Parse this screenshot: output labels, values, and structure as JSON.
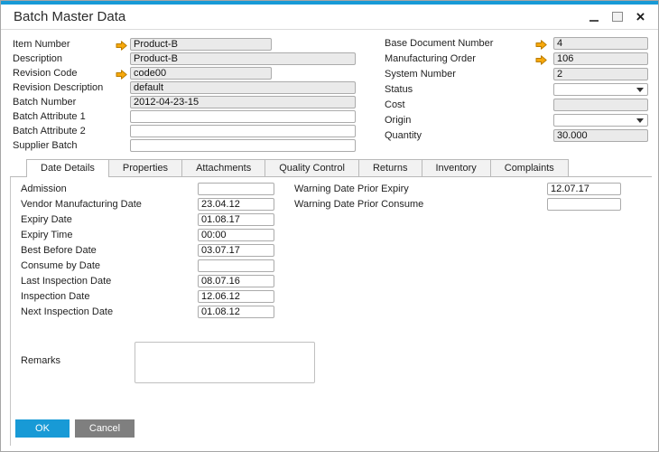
{
  "colors": {
    "accent_blue": "#189ad6",
    "ok_button_blue": "#189ad6",
    "cancel_button_gray": "#7f7f7f",
    "link_arrow_orange": "#f7a80b",
    "disabled_field_bg": "#eaeaea"
  },
  "icons": {
    "minimize": "underscore-shape",
    "maximize": "square-outline",
    "close": "×",
    "link_arrow": "orange-right-arrow",
    "dropdown_caret": "▾"
  },
  "window": {
    "title": "Batch Master Data"
  },
  "header_form": {
    "left_fields": [
      {
        "label": "Item Number",
        "value": "Product-B",
        "arrow": true,
        "type": "readonly",
        "size": "narrow"
      },
      {
        "label": "Description",
        "value": "Product-B",
        "arrow": false,
        "type": "readonly",
        "size": "wide"
      },
      {
        "label": "Revision Code",
        "value": "code00",
        "arrow": true,
        "type": "readonly",
        "size": "narrow"
      },
      {
        "label": "Revision Description",
        "value": "default",
        "arrow": false,
        "type": "readonly",
        "size": "wide"
      },
      {
        "label": "Batch Number",
        "value": "2012-04-23-15",
        "arrow": false,
        "type": "readonly",
        "size": "wide"
      },
      {
        "label": "Batch Attribute 1",
        "value": "",
        "arrow": false,
        "type": "input",
        "size": "wide"
      },
      {
        "label": "Batch Attribute 2",
        "value": "",
        "arrow": false,
        "type": "input",
        "size": "wide"
      },
      {
        "label": "Supplier Batch",
        "value": "",
        "arrow": false,
        "type": "input",
        "size": "wide"
      }
    ],
    "right_fields": [
      {
        "label": "Base Document Number",
        "value": "4",
        "arrow": true,
        "type": "readonly"
      },
      {
        "label": "Manufacturing Order",
        "value": "106",
        "arrow": true,
        "type": "readonly"
      },
      {
        "label": "System Number",
        "value": "2",
        "arrow": false,
        "type": "readonly"
      },
      {
        "label": "Status",
        "value": "",
        "arrow": false,
        "type": "dropdown"
      },
      {
        "label": "Cost",
        "value": "",
        "arrow": false,
        "type": "readonly"
      },
      {
        "label": "Origin",
        "value": "",
        "arrow": false,
        "type": "dropdown"
      },
      {
        "label": "Quantity",
        "value": "30.000",
        "arrow": false,
        "type": "readonly"
      }
    ]
  },
  "tabs": [
    {
      "label": "Date Details",
      "active": true
    },
    {
      "label": "Properties",
      "active": false
    },
    {
      "label": "Attachments",
      "active": false
    },
    {
      "label": "Quality Control",
      "active": false
    },
    {
      "label": "Returns",
      "active": false
    },
    {
      "label": "Inventory",
      "active": false
    },
    {
      "label": "Complaints",
      "active": false
    }
  ],
  "date_details_tab": {
    "date_fields": [
      {
        "label": "Admission",
        "value": ""
      },
      {
        "label": "Vendor Manufacturing Date",
        "value": "23.04.12"
      },
      {
        "label": "Expiry Date",
        "value": "01.08.17"
      },
      {
        "label": "Expiry Time",
        "value": "00:00"
      },
      {
        "label": "Best Before Date",
        "value": "03.07.17"
      },
      {
        "label": "Consume by Date",
        "value": ""
      },
      {
        "label": "Last Inspection Date",
        "value": "08.07.16"
      },
      {
        "label": "Inspection Date",
        "value": "12.06.12"
      },
      {
        "label": "Next Inspection Date",
        "value": "01.08.12"
      }
    ],
    "warning_fields": [
      {
        "label": "Warning Date Prior Expiry",
        "value": "12.07.17"
      },
      {
        "label": "Warning Date Prior Consume",
        "value": ""
      }
    ],
    "remarks": {
      "label": "Remarks",
      "value": ""
    }
  },
  "footer": {
    "ok_label": "OK",
    "cancel_label": "Cancel"
  }
}
